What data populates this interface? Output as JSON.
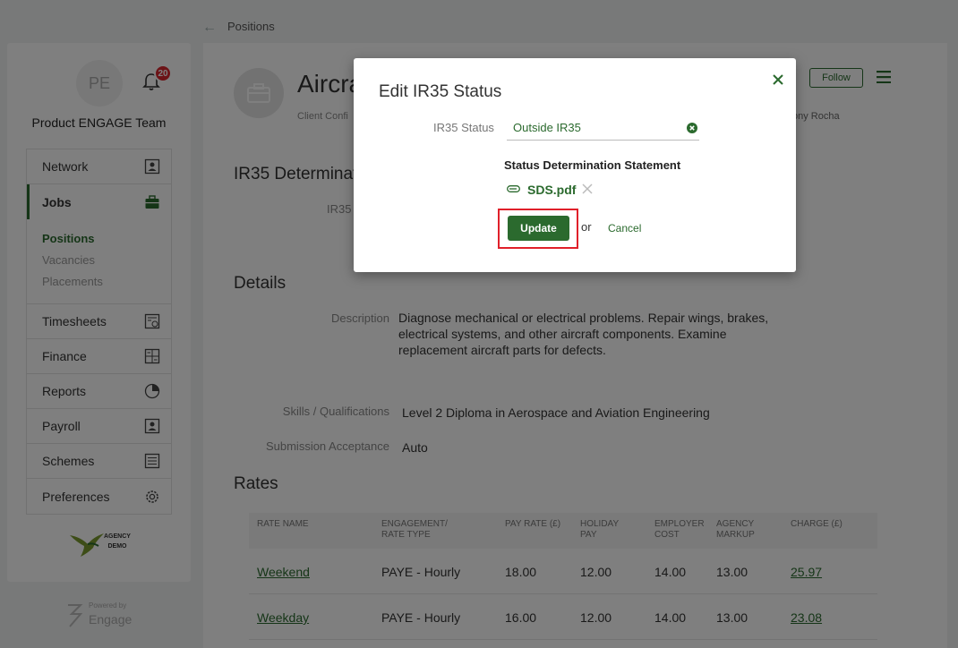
{
  "breadcrumb": {
    "back_icon": "arrow-left-icon",
    "label": "Positions"
  },
  "sidebar": {
    "avatar_initials": "PE",
    "notification_count": "20",
    "team_name": "Product ENGAGE Team",
    "nav": [
      {
        "label": "Network",
        "icon": "contact-card-icon"
      },
      {
        "label": "Jobs",
        "icon": "briefcase-icon"
      },
      {
        "label": "Timesheets",
        "icon": "timesheet-icon"
      },
      {
        "label": "Finance",
        "icon": "calculator-icon"
      },
      {
        "label": "Reports",
        "icon": "pie-chart-icon"
      },
      {
        "label": "Payroll",
        "icon": "person-card-icon"
      },
      {
        "label": "Schemes",
        "icon": "scheme-list-icon"
      },
      {
        "label": "Preferences",
        "icon": "gear-icon"
      }
    ],
    "jobs_sub": [
      "Positions",
      "Vacancies",
      "Placements"
    ],
    "agency_logo_text_1": "AGENCY",
    "agency_logo_text_2": "DEMO",
    "powered_by": "Powered by",
    "powered_brand": "Engage"
  },
  "job": {
    "title": "Aircra",
    "client_conf": "Client Confi",
    "follow_label": "Follow",
    "owner": "ony Rocha"
  },
  "sections": {
    "ir35_heading": "IR35 Determinat",
    "ir35_label": "IR35",
    "details_heading": "Details",
    "description_label": "Description",
    "description_text": "Diagnose mechanical or electrical problems. Repair wings, brakes, electrical systems, and other aircraft components. Examine replacement aircraft parts for defects.",
    "skills_label": "Skills / Qualifications",
    "skills_value": "Level 2 Diploma in Aerospace and Aviation Engineering",
    "submission_label": "Submission Acceptance",
    "submission_value": "Auto",
    "rates_heading": "Rates"
  },
  "rates": {
    "headers": [
      "RATE NAME",
      "ENGAGEMENT/\nRATE TYPE",
      "PAY RATE (£)",
      "HOLIDAY\nPAY",
      "EMPLOYER\nCOST",
      "AGENCY\nMARKUP",
      "CHARGE (£)"
    ],
    "rows": [
      [
        "Weekend",
        "PAYE - Hourly",
        "18.00",
        "12.00",
        "14.00",
        "13.00",
        "25.97"
      ],
      [
        "Weekday",
        "PAYE - Hourly",
        "16.00",
        "12.00",
        "14.00",
        "13.00",
        "23.08"
      ]
    ]
  },
  "modal": {
    "title": "Edit IR35 Status",
    "field_label": "IR35 Status",
    "field_value": "Outside IR35",
    "sds_heading": "Status Determination Statement",
    "file_name": "SDS.pdf",
    "update_label": "Update",
    "or_text": "or",
    "cancel_label": "Cancel"
  },
  "colors": {
    "brand_green": "#2b6a2e",
    "badge_red": "#d9272e",
    "highlight_red": "#e0202a"
  }
}
